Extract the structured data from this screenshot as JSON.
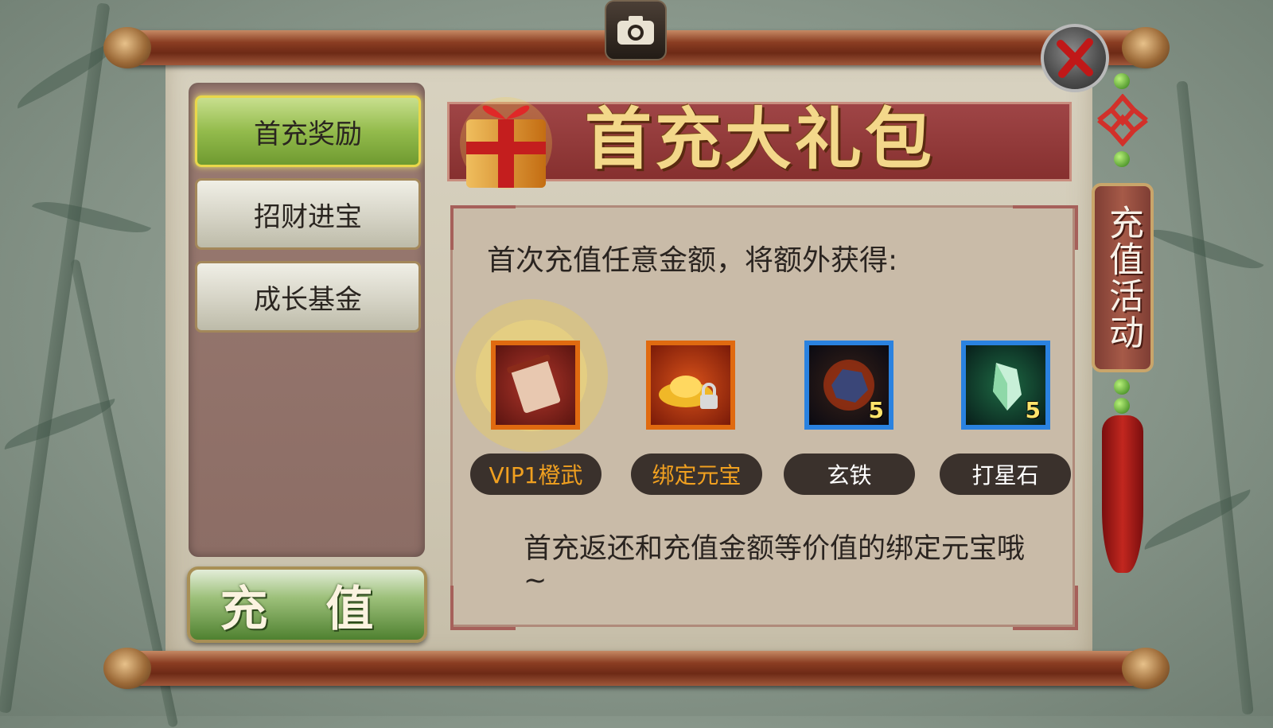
{
  "menu": {
    "tabs": [
      {
        "label": "首充奖励",
        "active": true
      },
      {
        "label": "招财进宝",
        "active": false
      },
      {
        "label": "成长基金",
        "active": false
      }
    ],
    "recharge_label": "充 值"
  },
  "banner": {
    "title": "首充大礼包"
  },
  "content": {
    "intro": "首次充值任意金额，将额外获得:",
    "description": "首充返还和充值金额等价值的绑定元宝哦~"
  },
  "rewards": [
    {
      "label": "VIP1橙武",
      "count": "",
      "label_color": "#f0a020",
      "frame_color": "#e06a10"
    },
    {
      "label": "绑定元宝",
      "count": "",
      "label_color": "#f0a020",
      "frame_color": "#e06a10"
    },
    {
      "label": "玄铁",
      "count": "5",
      "label_color": "#ffffff",
      "frame_color": "#2a82e0"
    },
    {
      "label": "打星石",
      "count": "5",
      "label_color": "#ffffff",
      "frame_color": "#2a82e0"
    }
  ],
  "side_tab": {
    "label": "充值活动"
  },
  "icons": {
    "camera": "camera-icon",
    "close": "close-icon",
    "gift": "gift-box-icon"
  },
  "colors": {
    "active_tab": "#93bb4c",
    "banner": "#86302f",
    "title_gold": "#f3d88a"
  }
}
